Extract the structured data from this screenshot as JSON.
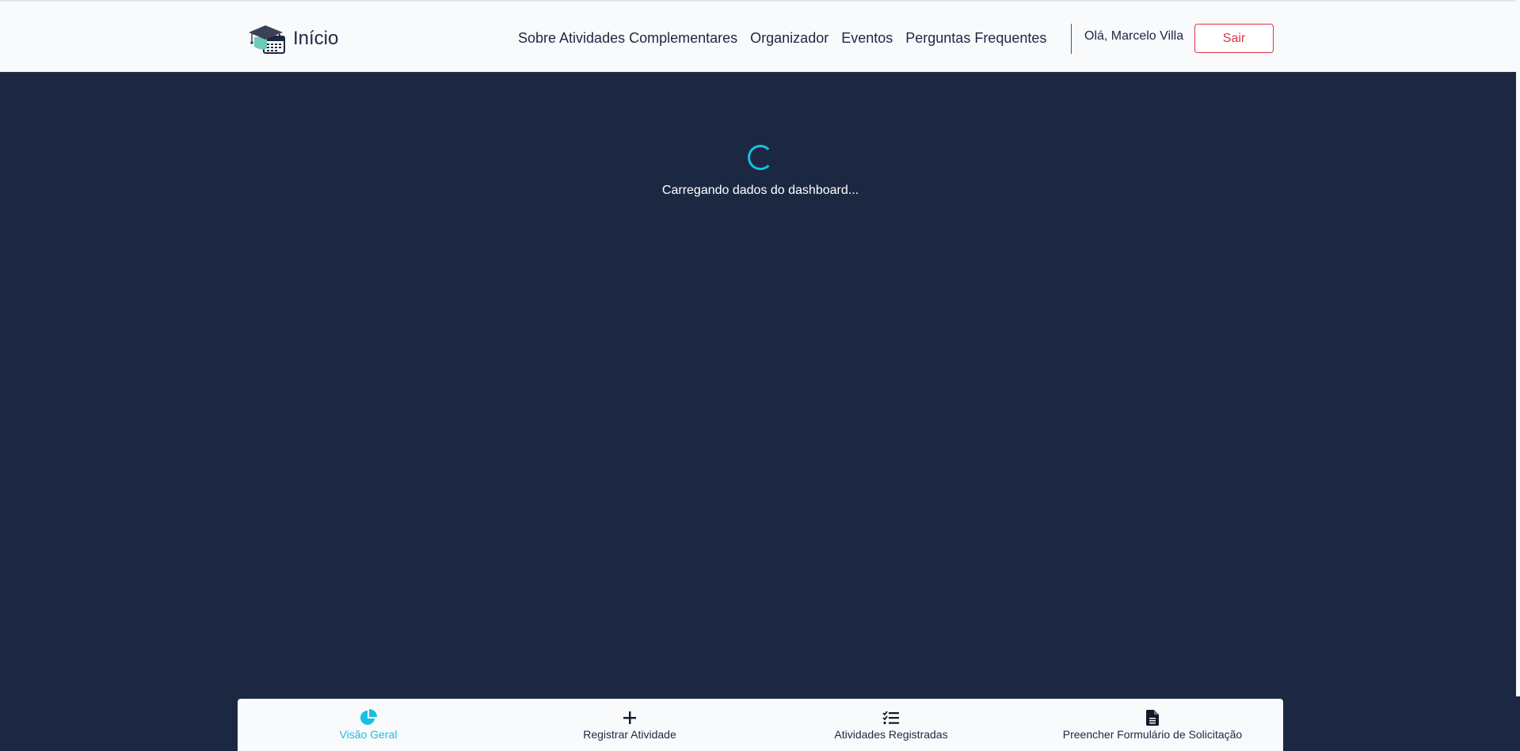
{
  "header": {
    "brand_label": "Início",
    "nav": [
      {
        "label": "Sobre Atividades Complementares"
      },
      {
        "label": "Organizador"
      },
      {
        "label": "Eventos"
      },
      {
        "label": "Perguntas Frequentes"
      }
    ],
    "greeting": "Olá, Marcelo Villa",
    "logout_label": "Sair"
  },
  "loading": {
    "message": "Carregando dados do dashboard..."
  },
  "bottom_nav": {
    "items": [
      {
        "label": "Visão Geral",
        "icon": "pie-chart-icon",
        "active": true
      },
      {
        "label": "Registrar Atividade",
        "icon": "plus-icon",
        "active": false
      },
      {
        "label": "Atividades Registradas",
        "icon": "checklist-icon",
        "active": false
      },
      {
        "label": "Preencher Formulário de Solicitação",
        "icon": "document-icon",
        "active": false
      }
    ]
  },
  "colors": {
    "background": "#1c2841",
    "header_bg": "#f8fafc",
    "accent": "#17c0e3",
    "danger": "#dc3545",
    "text_dark": "#1c2841"
  }
}
